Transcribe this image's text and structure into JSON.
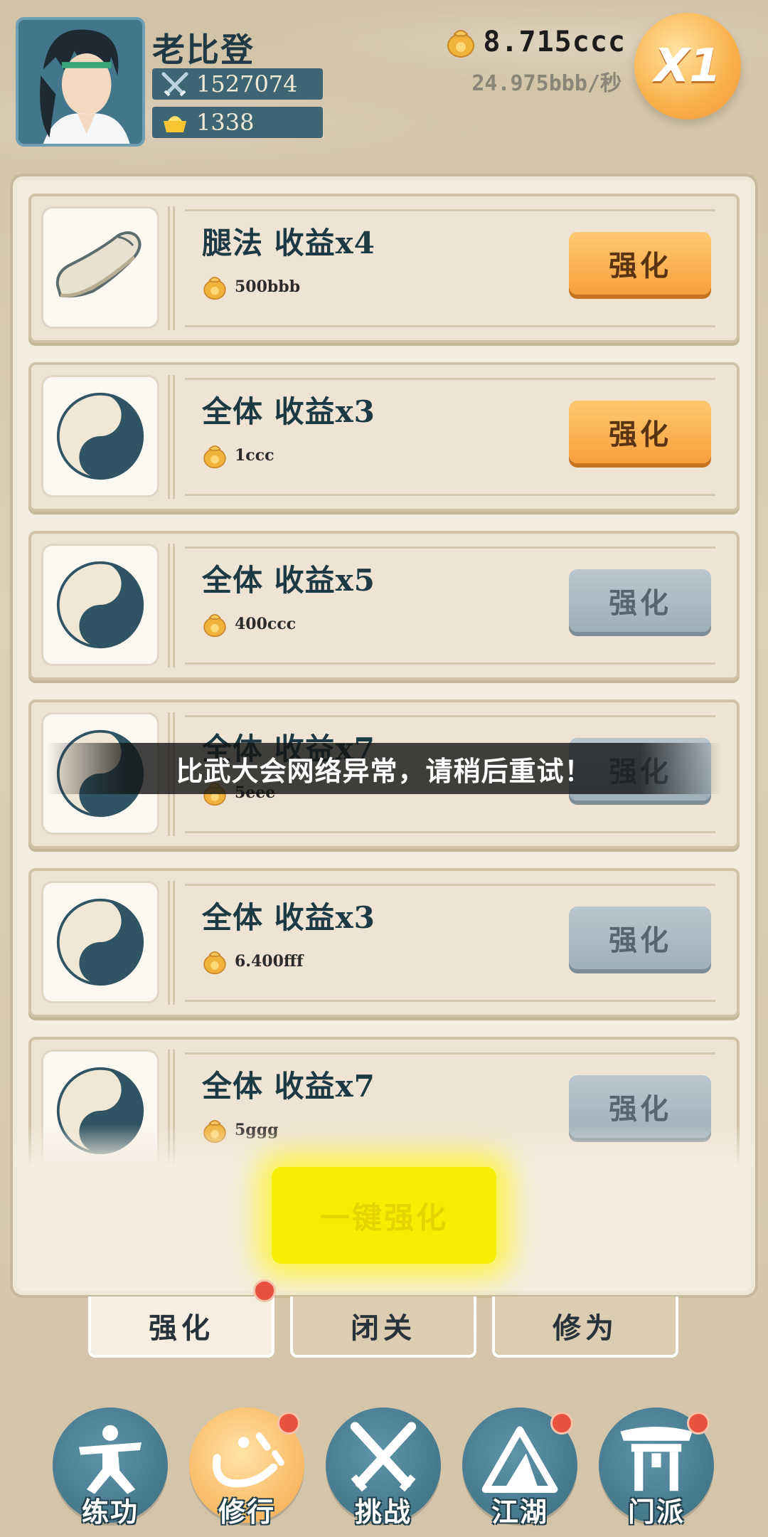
{
  "player": {
    "name": "老比登",
    "power": "1527074",
    "gold": "1338"
  },
  "currency": {
    "total": "8.715ccc",
    "rate": "24.975bbb/秒"
  },
  "speed": {
    "label": "X1"
  },
  "items": [
    {
      "icon": "shoe-icon",
      "title": "腿法 收益x4",
      "cost": "500bbb",
      "button": "强化",
      "enabled": true
    },
    {
      "icon": "yin-yang-icon",
      "title": "全体 收益x3",
      "cost": "1ccc",
      "button": "强化",
      "enabled": true
    },
    {
      "icon": "yin-yang-icon",
      "title": "全体 收益x5",
      "cost": "400ccc",
      "button": "强化",
      "enabled": false
    },
    {
      "icon": "yin-yang-icon",
      "title": "全体 收益x7",
      "cost": "5eee",
      "button": "强化",
      "enabled": false
    },
    {
      "icon": "yin-yang-icon",
      "title": "全体 收益x3",
      "cost": "6.400fff",
      "button": "强化",
      "enabled": false
    },
    {
      "icon": "yin-yang-icon",
      "title": "全体 收益x7",
      "cost": "5ggg",
      "button": "强化",
      "enabled": false
    }
  ],
  "one_key": {
    "label": "一键强化"
  },
  "tabs": [
    {
      "label": "强化",
      "active": true
    },
    {
      "label": "闭关",
      "active": false
    },
    {
      "label": "修为",
      "active": false
    }
  ],
  "nav": [
    {
      "label": "练功",
      "icon": "kungfu-figure-icon",
      "active": false,
      "badge": false
    },
    {
      "label": "修行",
      "icon": "heart-icon",
      "active": true,
      "badge": true
    },
    {
      "label": "挑战",
      "icon": "crossed-swords-icon",
      "active": false,
      "badge": false
    },
    {
      "label": "江湖",
      "icon": "mountain-icon",
      "active": false,
      "badge": true
    },
    {
      "label": "门派",
      "icon": "gate-icon",
      "active": false,
      "badge": true
    }
  ],
  "toast": {
    "message": "比武大会网络异常，请稍后重试！"
  },
  "colors": {
    "accent_orange": "#f8a03c",
    "disabled_gray": "#9eb0bb",
    "teal": "#3d6574",
    "glow_yellow": "#f5ee00",
    "badge_red": "#e8513f"
  }
}
